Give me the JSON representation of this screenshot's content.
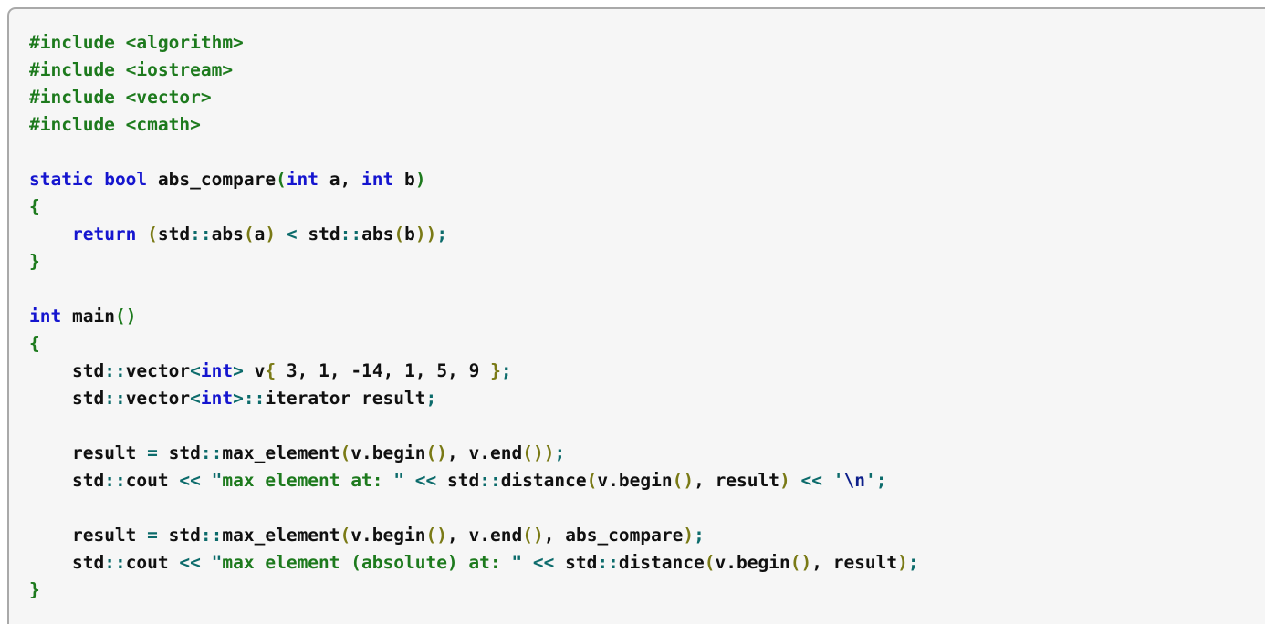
{
  "window": {
    "kind": "code-snippet-block",
    "language": "cpp",
    "background_color": "#f6f6f6",
    "border_color": "#a9a9a9",
    "page_background": "#ffffff"
  },
  "palette": {
    "preprocessor": "#1d7a1d",
    "keyword": "#1515cf",
    "identifier": "#101010",
    "operator": "#0c6b6b",
    "string": "#1d7a1d",
    "escape": "#0d1f8a",
    "bracket_level_0": "#1d7a1d",
    "bracket_level_1": "#7a7a16"
  },
  "code": {
    "line_count": 21,
    "lines": [
      "#include <algorithm>",
      "#include <iostream>",
      "#include <vector>",
      "#include <cmath>",
      "",
      "static bool abs_compare(int a, int b)",
      "{",
      "    return (std::abs(a) < std::abs(b));",
      "}",
      "",
      "int main()",
      "{",
      "    std::vector<int> v{ 3, 1, -14, 1, 5, 9 };",
      "    std::vector<int>::iterator result;",
      "",
      "    result = std::max_element(v.begin(), v.end());",
      "    std::cout << \"max element at: \" << std::distance(v.begin(), result) << '\\n';",
      "",
      "    result = std::max_element(v.begin(), v.end(), abs_compare);",
      "    std::cout << \"max element (absolute) at: \" << std::distance(v.begin(), result);",
      "}"
    ],
    "tokens": {
      "include_directive": "#include",
      "headers": [
        "<algorithm>",
        "<iostream>",
        "<vector>",
        "<cmath>"
      ],
      "keywords": [
        "static",
        "bool",
        "int",
        "return"
      ],
      "functions": [
        "abs_compare",
        "main",
        "std::abs",
        "std::max_element",
        "std::distance",
        "v.begin",
        "v.end"
      ],
      "types": [
        "std::vector<int>",
        "std::vector<int>::iterator"
      ],
      "variables": [
        "a",
        "b",
        "v",
        "result"
      ],
      "vector_literal": [
        "3",
        "1",
        "-14",
        "1",
        "5",
        "9"
      ],
      "strings": [
        "\"max element at: \"",
        "\"max element (absolute) at: \""
      ],
      "char_literals": [
        "'\\n'"
      ],
      "stream_object": "std::cout",
      "stream_operator": "<<"
    }
  }
}
